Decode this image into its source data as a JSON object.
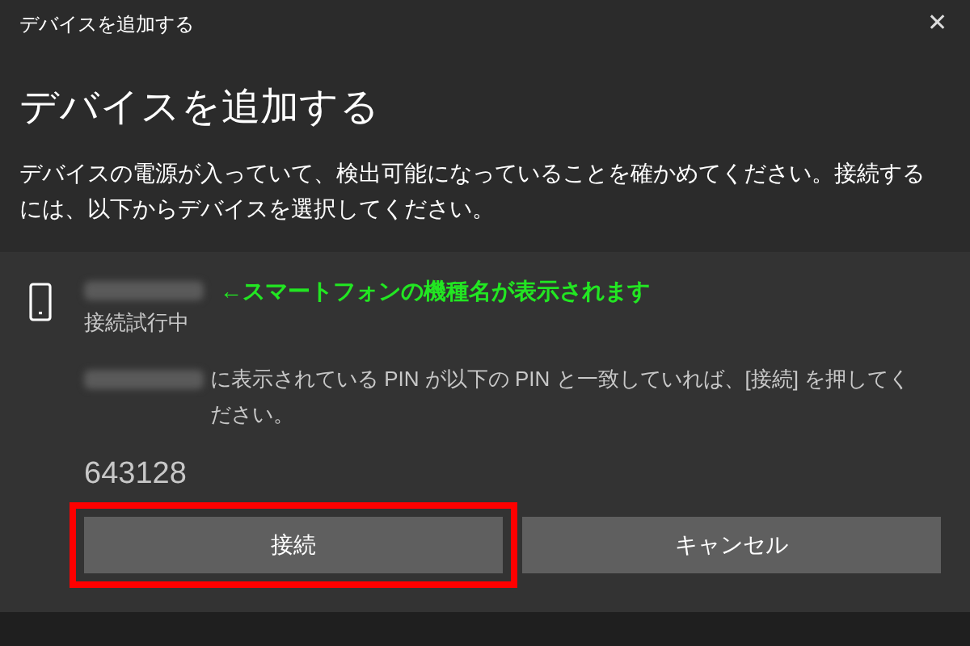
{
  "window": {
    "title": "デバイスを追加する",
    "close": "✕"
  },
  "heading": "デバイスを追加する",
  "description": "デバイスの電源が入っていて、検出可能になっていることを確かめてください。接続するには、以下からデバイスを選択してください。",
  "device": {
    "annotation": "←スマートフォンの機種名が表示されます",
    "status": "接続試行中",
    "instruction": "に表示されている PIN が以下の PIN と一致していれば、[接続] を押してください。",
    "pin": "643128"
  },
  "buttons": [
    {
      "label": "接続",
      "highlighted": true
    },
    {
      "label": "キャンセル",
      "highlighted": false
    }
  ]
}
